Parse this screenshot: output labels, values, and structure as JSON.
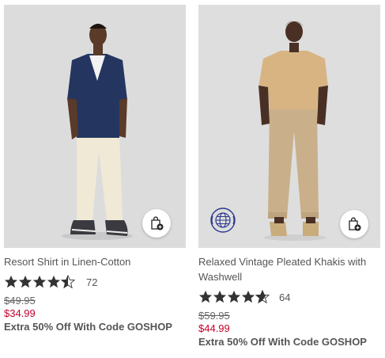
{
  "products": [
    {
      "title": "Resort Shirt in Linen-Cotton",
      "rating": 4.5,
      "review_count": "72",
      "original_price": "$49.95",
      "sale_price": "$34.99",
      "promo": "Extra 50% Off With Code GOSHOP",
      "icons": {
        "bag": "shopping-bag-icon"
      }
    },
    {
      "title": "Relaxed Vintage Pleated Khakis with Washwell",
      "rating": 4.5,
      "review_count": "64",
      "original_price": "$59.95",
      "sale_price": "$44.99",
      "promo": "Extra 50% Off With Code GOSHOP",
      "icons": {
        "bag": "shopping-bag-icon",
        "badge": "washwell-globe-icon"
      }
    }
  ],
  "colors": {
    "sale": "#c4002b",
    "badge_blue": "#2b3a8c",
    "star": "#333333"
  }
}
